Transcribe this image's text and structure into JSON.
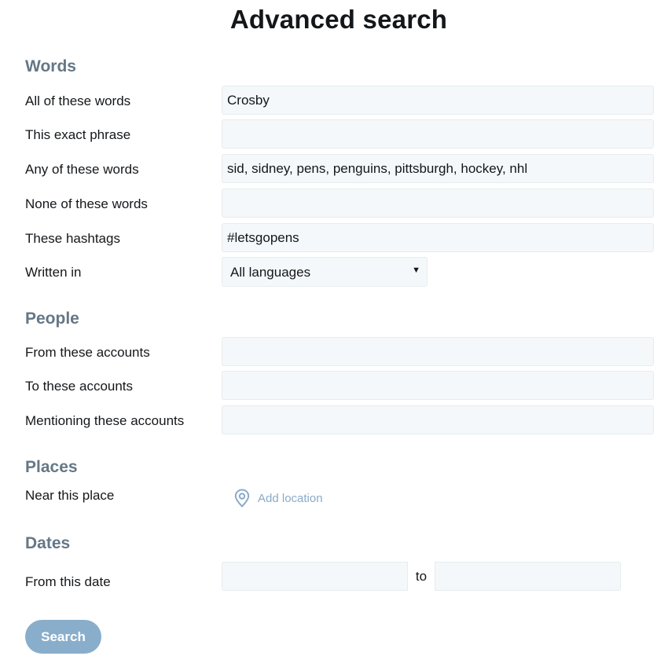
{
  "page": {
    "title": "Advanced search"
  },
  "words": {
    "heading": "Words",
    "all_label": "All of these words",
    "all_value": "Crosby",
    "exact_label": "This exact phrase",
    "exact_value": "",
    "any_label": "Any of these words",
    "any_value": "sid, sidney, pens, penguins, pittsburgh, hockey, nhl",
    "none_label": "None of these words",
    "none_value": "",
    "hashtags_label": "These hashtags",
    "hashtags_value": "#letsgopens",
    "language_label": "Written in",
    "language_value": "All languages"
  },
  "people": {
    "heading": "People",
    "from_label": "From these accounts",
    "from_value": "",
    "to_label": "To these accounts",
    "to_value": "",
    "mentioning_label": "Mentioning these accounts",
    "mentioning_value": ""
  },
  "places": {
    "heading": "Places",
    "near_label": "Near this place",
    "add_location": "Add location",
    "location_icon": "location-pin-icon"
  },
  "dates": {
    "heading": "Dates",
    "from_label": "From this date",
    "separator": "to",
    "from_value": "",
    "to_value": ""
  },
  "actions": {
    "search_label": "Search"
  },
  "colors": {
    "heading_gray": "#657786",
    "field_bg": "#f5f8fa",
    "field_border": "#e6ecf0",
    "link_blue": "#8aaac8",
    "button_bg": "#89aecb"
  }
}
